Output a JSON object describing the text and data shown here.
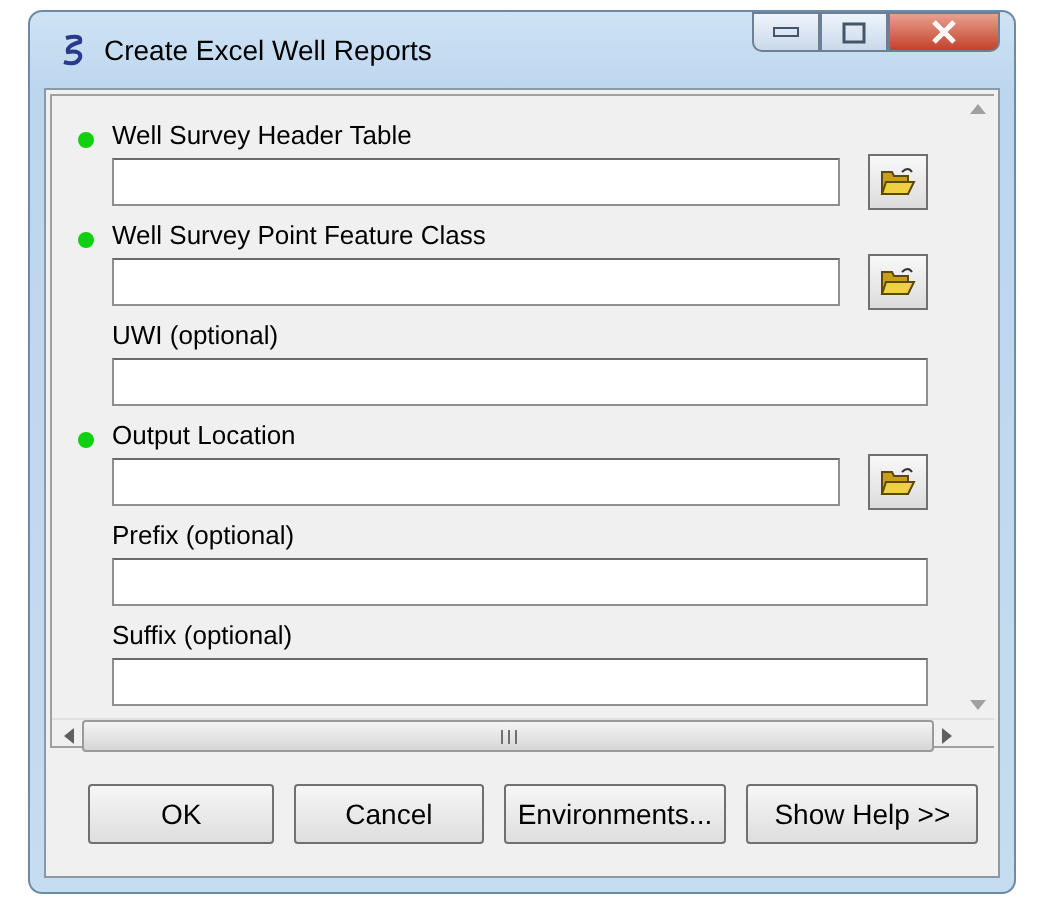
{
  "window": {
    "title": "Create Excel Well Reports"
  },
  "parameters": [
    {
      "label": "Well Survey Header Table",
      "required": true,
      "browse": true
    },
    {
      "label": "Well Survey Point Feature Class",
      "required": true,
      "browse": true
    },
    {
      "label": "UWI (optional)",
      "required": false,
      "browse": false
    },
    {
      "label": "Output Location",
      "required": true,
      "browse": true
    },
    {
      "label": "Prefix (optional)",
      "required": false,
      "browse": false
    },
    {
      "label": "Suffix (optional)",
      "required": false,
      "browse": false
    }
  ],
  "buttons": [
    "OK",
    "Cancel",
    "Environments...",
    "Show Help >>"
  ]
}
